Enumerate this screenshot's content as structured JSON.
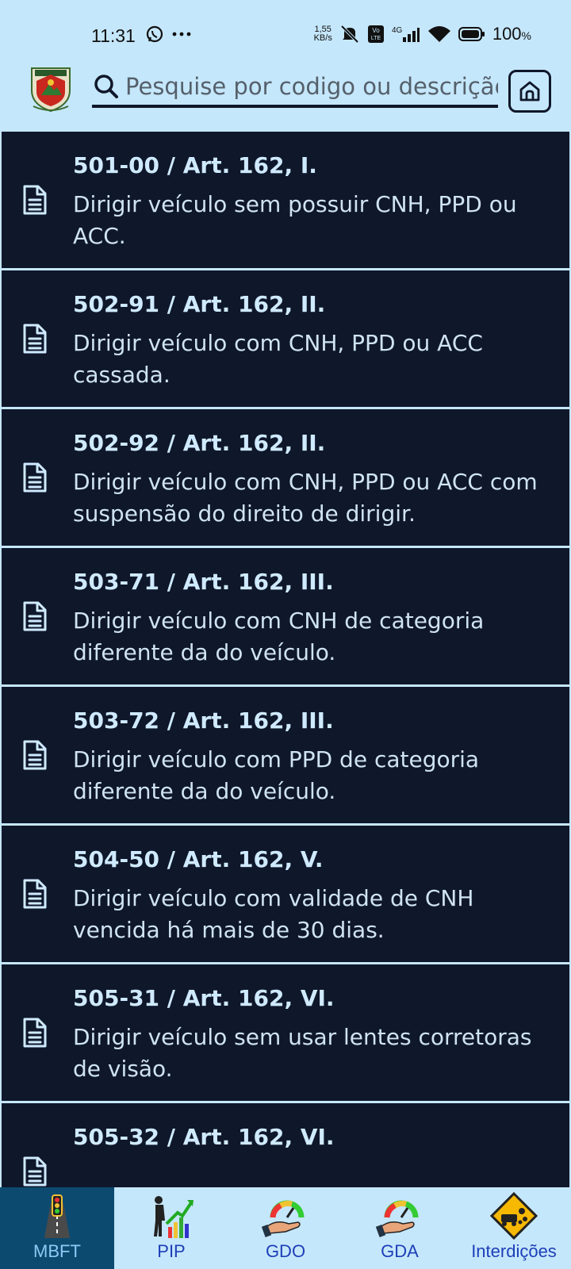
{
  "status_bar": {
    "time": "11:31",
    "net_speed_value": "1,55",
    "net_speed_unit": "KB/s",
    "battery": "100",
    "battery_unit": "%"
  },
  "search": {
    "placeholder": "Pesquise por codigo ou descrição"
  },
  "items": [
    {
      "title": "501-00 / Art. 162, I.",
      "description": "Dirigir veículo sem possuir CNH, PPD ou ACC."
    },
    {
      "title": "502-91 / Art. 162, II.",
      "description": "Dirigir veículo com CNH, PPD ou ACC cassada."
    },
    {
      "title": "502-92 / Art. 162, II.",
      "description": "Dirigir veículo com CNH, PPD ou ACC com suspensão do direito de dirigir."
    },
    {
      "title": "503-71 / Art. 162, III.",
      "description": "Dirigir veículo com CNH de categoria diferente da do veículo."
    },
    {
      "title": "503-72 / Art. 162, III.",
      "description": "Dirigir veículo com PPD de categoria diferente da do veículo."
    },
    {
      "title": "504-50 / Art. 162, V.",
      "description": "Dirigir veículo com validade de CNH vencida há mais de 30 dias."
    },
    {
      "title": "505-31 / Art. 162, VI.",
      "description": "Dirigir veículo sem usar lentes corretoras de visão."
    },
    {
      "title": "505-32 / Art. 162, VI.",
      "description": ""
    }
  ],
  "nav": [
    {
      "label": "MBFT",
      "icon": "traffic-light-road-icon",
      "active": true
    },
    {
      "label": "PIP",
      "icon": "soldier-chart-icon",
      "active": false
    },
    {
      "label": "GDO",
      "icon": "gauge-hand-icon",
      "active": false
    },
    {
      "label": "GDA",
      "icon": "gauge-hand-icon",
      "active": false
    },
    {
      "label": "Interdições",
      "icon": "falling-rocks-sign-icon",
      "active": false
    }
  ]
}
